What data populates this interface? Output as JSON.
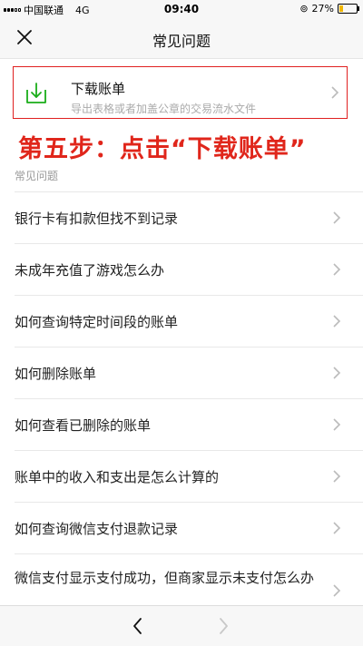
{
  "status_bar": {
    "carrier": "中国联通",
    "network": "4G",
    "time": "09:40",
    "battery": "27%",
    "battery_level": 27,
    "battery_color": "#f0b600"
  },
  "nav": {
    "title": "常见问题",
    "close_icon": "close-icon"
  },
  "download_card": {
    "title": "下载账单",
    "subtitle": "导出表格或者加盖公章的交易流水文件",
    "icon": "download-icon",
    "highlight_color": "#e02020",
    "icon_color": "#1aad19"
  },
  "annotation": {
    "text": "第五步：点击“下载账单”",
    "color": "#e0261b"
  },
  "faq": {
    "section_label": "常见问题",
    "items": [
      {
        "label": "银行卡有扣款但找不到记录"
      },
      {
        "label": "未成年充值了游戏怎么办"
      },
      {
        "label": "如何查询特定时间段的账单"
      },
      {
        "label": "如何删除账单"
      },
      {
        "label": "如何查看已删除的账单"
      },
      {
        "label": "账单中的收入和支出是怎么计算的"
      },
      {
        "label": "如何查询微信支付退款记录"
      },
      {
        "label": "微信支付显示支付成功，但商家显示未支付怎么办"
      }
    ]
  },
  "bottom_bar": {
    "back_icon": "back-arrow-icon",
    "forward_icon": "forward-arrow-icon"
  }
}
